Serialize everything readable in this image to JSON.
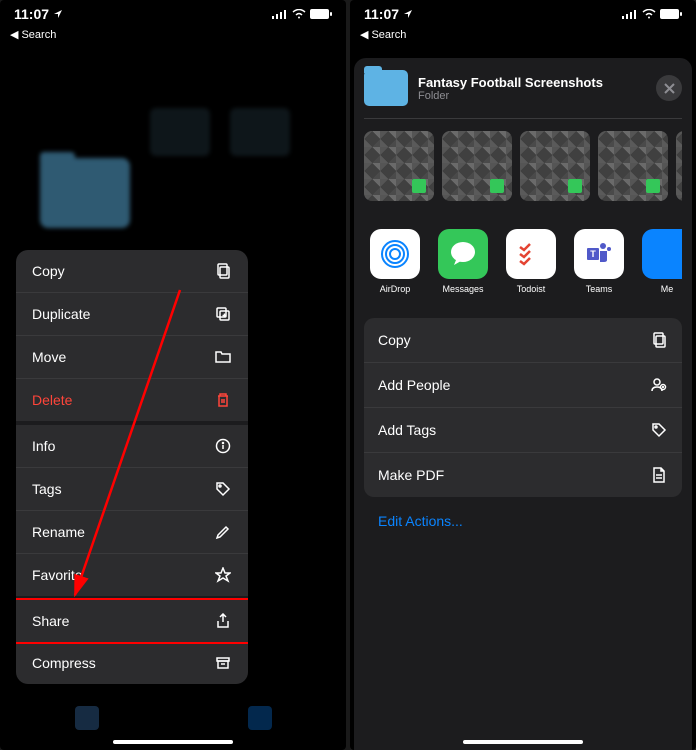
{
  "status": {
    "time": "11:07",
    "back_label": "Search"
  },
  "left_phone": {
    "menu": [
      {
        "label": "Copy",
        "icon": "copy-icon",
        "destructive": false,
        "thick": false
      },
      {
        "label": "Duplicate",
        "icon": "duplicate-icon",
        "destructive": false,
        "thick": false
      },
      {
        "label": "Move",
        "icon": "folder-icon",
        "destructive": false,
        "thick": false
      },
      {
        "label": "Delete",
        "icon": "trash-icon",
        "destructive": true,
        "thick": true
      },
      {
        "label": "Info",
        "icon": "info-icon",
        "destructive": false,
        "thick": false
      },
      {
        "label": "Tags",
        "icon": "tag-icon",
        "destructive": false,
        "thick": false
      },
      {
        "label": "Rename",
        "icon": "pencil-icon",
        "destructive": false,
        "thick": false
      },
      {
        "label": "Favorite",
        "icon": "star-icon",
        "destructive": false,
        "thick": true
      },
      {
        "label": "Share",
        "icon": "share-icon",
        "destructive": false,
        "thick": false,
        "highlighted": true
      },
      {
        "label": "Compress",
        "icon": "archive-icon",
        "destructive": false,
        "thick": false
      }
    ]
  },
  "right_phone": {
    "sheet_title": "Fantasy Football Screenshots",
    "sheet_subtitle": "Folder",
    "apps": [
      {
        "label": "AirDrop",
        "bg": "#ffffff",
        "content": "airdrop"
      },
      {
        "label": "Messages",
        "bg": "#34c759",
        "content": "messages"
      },
      {
        "label": "Todoist",
        "bg": "#ffffff",
        "content": "todoist"
      },
      {
        "label": "Teams",
        "bg": "#ffffff",
        "content": "teams"
      },
      {
        "label": "Me",
        "bg": "#0a84ff",
        "content": ""
      }
    ],
    "actions": [
      {
        "label": "Copy",
        "icon": "copy-icon"
      },
      {
        "label": "Add People",
        "icon": "add-people-icon"
      },
      {
        "label": "Add Tags",
        "icon": "tag-icon"
      },
      {
        "label": "Make PDF",
        "icon": "document-icon"
      }
    ],
    "edit_actions": "Edit Actions..."
  }
}
